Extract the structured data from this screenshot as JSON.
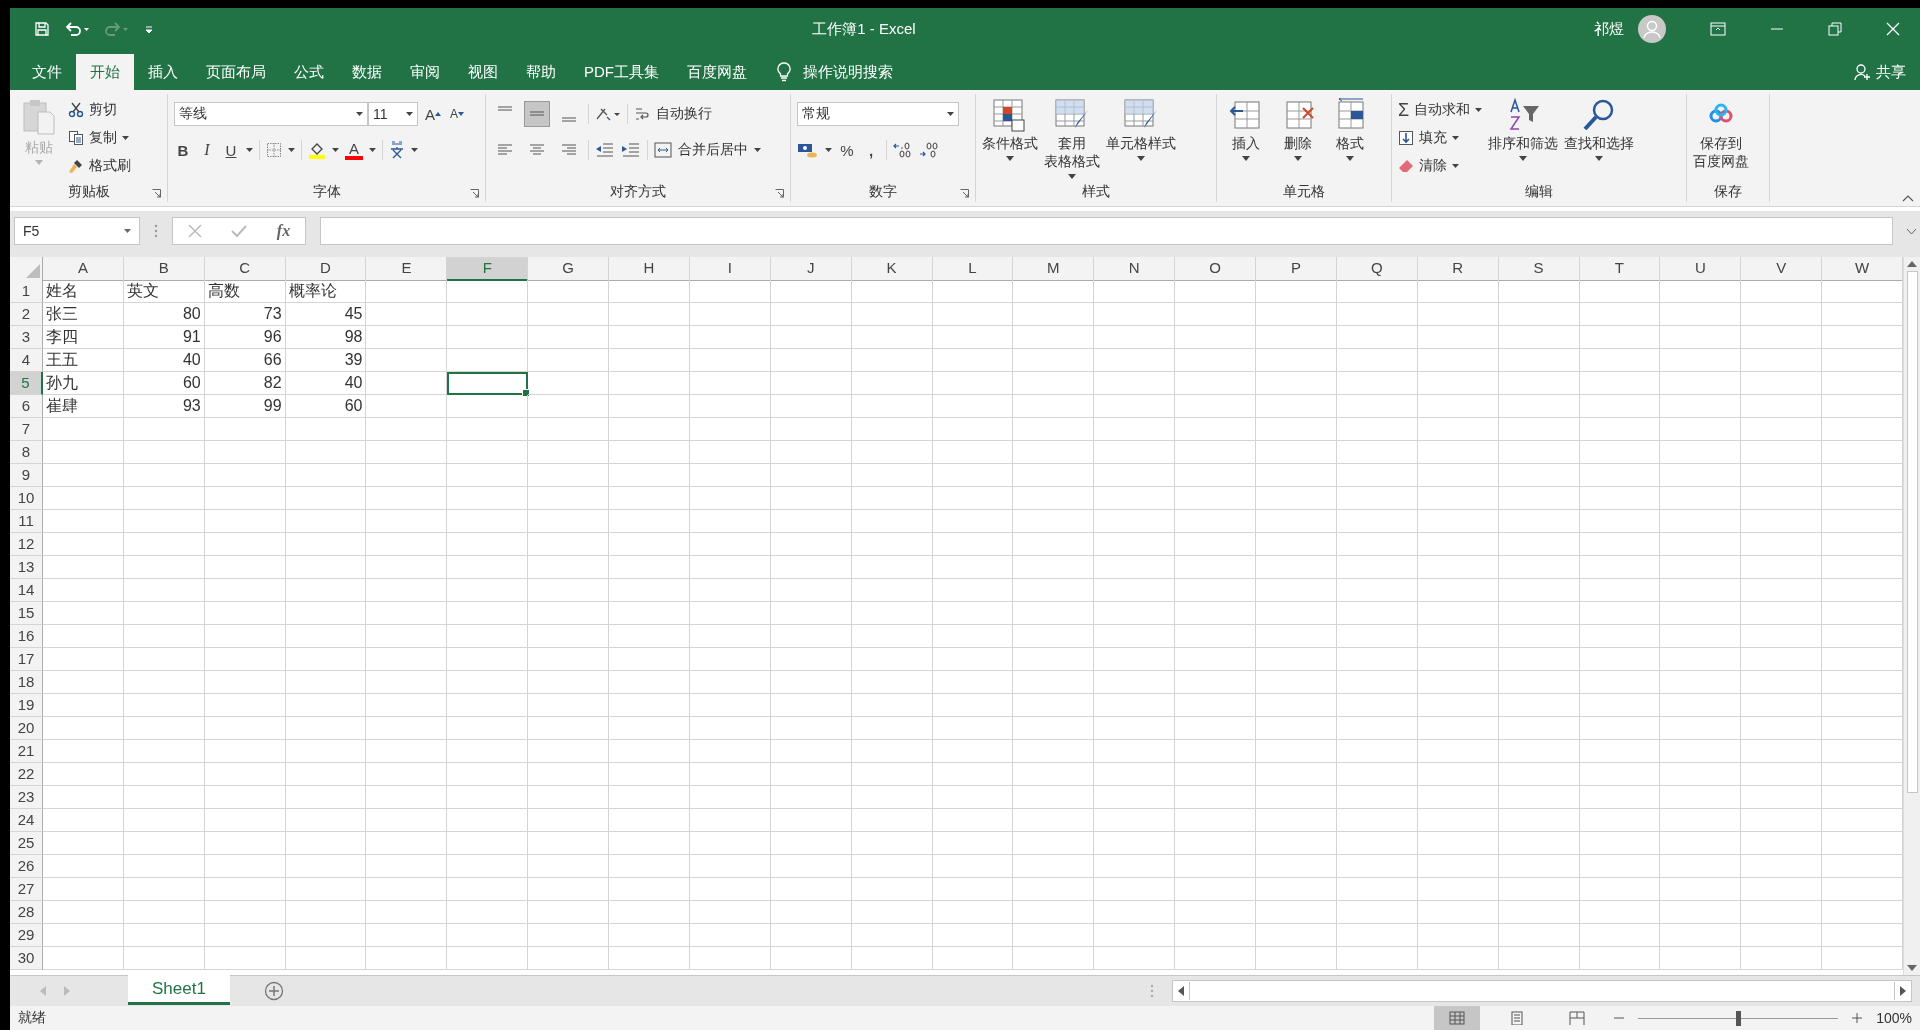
{
  "window": {
    "title": "工作簿1 - Excel",
    "user": "祁煜",
    "share": "共享"
  },
  "ribbon_tabs": [
    {
      "label": "文件",
      "selected": false
    },
    {
      "label": "开始",
      "selected": true
    },
    {
      "label": "插入",
      "selected": false
    },
    {
      "label": "页面布局",
      "selected": false
    },
    {
      "label": "公式",
      "selected": false
    },
    {
      "label": "数据",
      "selected": false
    },
    {
      "label": "审阅",
      "selected": false
    },
    {
      "label": "视图",
      "selected": false
    },
    {
      "label": "帮助",
      "selected": false
    },
    {
      "label": "PDF工具集",
      "selected": false
    },
    {
      "label": "百度网盘",
      "selected": false
    }
  ],
  "tell_me": {
    "placeholder": "操作说明搜索"
  },
  "ribbon": {
    "clipboard": {
      "label": "剪贴板",
      "paste": "粘贴",
      "cut": "剪切",
      "copy": "复制",
      "format_painter": "格式刷"
    },
    "font": {
      "label": "字体",
      "font_name": "等线",
      "font_size": "11",
      "grow": "A",
      "shrink": "A",
      "bold": "B",
      "italic": "I",
      "underline": "U",
      "font_color": "A"
    },
    "alignment": {
      "label": "对齐方式",
      "middle_align_selected": true,
      "wrap_text": "自动换行",
      "merge_center": "合并后居中"
    },
    "number": {
      "label": "数字",
      "format": "常规",
      "percent": "%",
      "comma": ","
    },
    "styles": {
      "label": "样式",
      "buttons": [
        {
          "lines": [
            "条件格式"
          ]
        },
        {
          "lines": [
            "套用",
            "表格格式"
          ]
        },
        {
          "lines": [
            "单元格样式"
          ]
        }
      ]
    },
    "cells": {
      "label": "单元格",
      "buttons": [
        "插入",
        "删除",
        "格式"
      ]
    },
    "editing": {
      "label": "编辑",
      "sigma": "Σ",
      "autosum": "自动求和",
      "fill": "填充",
      "clear": "清除",
      "sort_filter": "排序和筛选",
      "find_select": "查找和选择"
    },
    "save": {
      "label": "保存",
      "lines": [
        "保存到",
        "百度网盘"
      ]
    }
  },
  "formula_bar": {
    "name_box": "F5",
    "fx": "fx"
  },
  "columns": [
    {
      "label": "A",
      "selected": false
    },
    {
      "label": "B",
      "selected": false
    },
    {
      "label": "C",
      "selected": false
    },
    {
      "label": "D",
      "selected": false
    },
    {
      "label": "E",
      "selected": false
    },
    {
      "label": "F",
      "selected": true
    },
    {
      "label": "G",
      "selected": false
    },
    {
      "label": "H",
      "selected": false
    },
    {
      "label": "I",
      "selected": false
    },
    {
      "label": "J",
      "selected": false
    },
    {
      "label": "K",
      "selected": false
    },
    {
      "label": "L",
      "selected": false
    },
    {
      "label": "M",
      "selected": false
    },
    {
      "label": "N",
      "selected": false
    },
    {
      "label": "O",
      "selected": false
    },
    {
      "label": "P",
      "selected": false
    },
    {
      "label": "Q",
      "selected": false
    },
    {
      "label": "R",
      "selected": false
    },
    {
      "label": "S",
      "selected": false
    },
    {
      "label": "T",
      "selected": false
    },
    {
      "label": "U",
      "selected": false
    },
    {
      "label": "V",
      "selected": false
    },
    {
      "label": "W",
      "selected": false
    }
  ],
  "rows": [
    {
      "label": "1",
      "selected": false,
      "cells": [
        {
          "value": "姓名",
          "kind": "text"
        },
        {
          "value": "英文",
          "kind": "text"
        },
        {
          "value": "高数",
          "kind": "text"
        },
        {
          "value": "概率论",
          "kind": "text"
        }
      ]
    },
    {
      "label": "2",
      "selected": false,
      "cells": [
        {
          "value": "张三",
          "kind": "text"
        },
        {
          "value": "80",
          "kind": "number"
        },
        {
          "value": "73",
          "kind": "number"
        },
        {
          "value": "45",
          "kind": "number"
        }
      ]
    },
    {
      "label": "3",
      "selected": false,
      "cells": [
        {
          "value": "李四",
          "kind": "text"
        },
        {
          "value": "91",
          "kind": "number"
        },
        {
          "value": "96",
          "kind": "number"
        },
        {
          "value": "98",
          "kind": "number"
        }
      ]
    },
    {
      "label": "4",
      "selected": false,
      "cells": [
        {
          "value": "王五",
          "kind": "text"
        },
        {
          "value": "40",
          "kind": "number"
        },
        {
          "value": "66",
          "kind": "number"
        },
        {
          "value": "39",
          "kind": "number"
        }
      ]
    },
    {
      "label": "5",
      "selected": true,
      "cells": [
        {
          "value": "孙九",
          "kind": "text"
        },
        {
          "value": "60",
          "kind": "number"
        },
        {
          "value": "82",
          "kind": "number"
        },
        {
          "value": "40",
          "kind": "number"
        }
      ]
    },
    {
      "label": "6",
      "selected": false,
      "cells": [
        {
          "value": "崔肆",
          "kind": "text"
        },
        {
          "value": "93",
          "kind": "number"
        },
        {
          "value": "99",
          "kind": "number"
        },
        {
          "value": "60",
          "kind": "number"
        }
      ]
    },
    {
      "label": "7",
      "selected": false,
      "cells": []
    },
    {
      "label": "8",
      "selected": false,
      "cells": []
    },
    {
      "label": "9",
      "selected": false,
      "cells": []
    },
    {
      "label": "10",
      "selected": false,
      "cells": []
    },
    {
      "label": "11",
      "selected": false,
      "cells": []
    },
    {
      "label": "12",
      "selected": false,
      "cells": []
    },
    {
      "label": "13",
      "selected": false,
      "cells": []
    },
    {
      "label": "14",
      "selected": false,
      "cells": []
    },
    {
      "label": "15",
      "selected": false,
      "cells": []
    },
    {
      "label": "16",
      "selected": false,
      "cells": []
    },
    {
      "label": "17",
      "selected": false,
      "cells": []
    },
    {
      "label": "18",
      "selected": false,
      "cells": []
    },
    {
      "label": "19",
      "selected": false,
      "cells": []
    },
    {
      "label": "20",
      "selected": false,
      "cells": []
    },
    {
      "label": "21",
      "selected": false,
      "cells": []
    },
    {
      "label": "22",
      "selected": false,
      "cells": []
    },
    {
      "label": "23",
      "selected": false,
      "cells": []
    },
    {
      "label": "24",
      "selected": false,
      "cells": []
    },
    {
      "label": "25",
      "selected": false,
      "cells": []
    },
    {
      "label": "26",
      "selected": false,
      "cells": []
    },
    {
      "label": "27",
      "selected": false,
      "cells": []
    },
    {
      "label": "28",
      "selected": false,
      "cells": []
    },
    {
      "label": "29",
      "selected": false,
      "cells": []
    },
    {
      "label": "30",
      "selected": false,
      "cells": []
    }
  ],
  "sheet_tabs": [
    {
      "label": "Sheet1",
      "selected": true
    }
  ],
  "status_bar": {
    "text": "就绪",
    "view_modes": [
      {
        "kind": "normal",
        "selected": true
      },
      {
        "kind": "page_layout",
        "selected": false
      },
      {
        "kind": "page_break",
        "selected": false
      }
    ],
    "zoom_slider": {
      "level": 0.5
    },
    "zoom": "100%"
  }
}
